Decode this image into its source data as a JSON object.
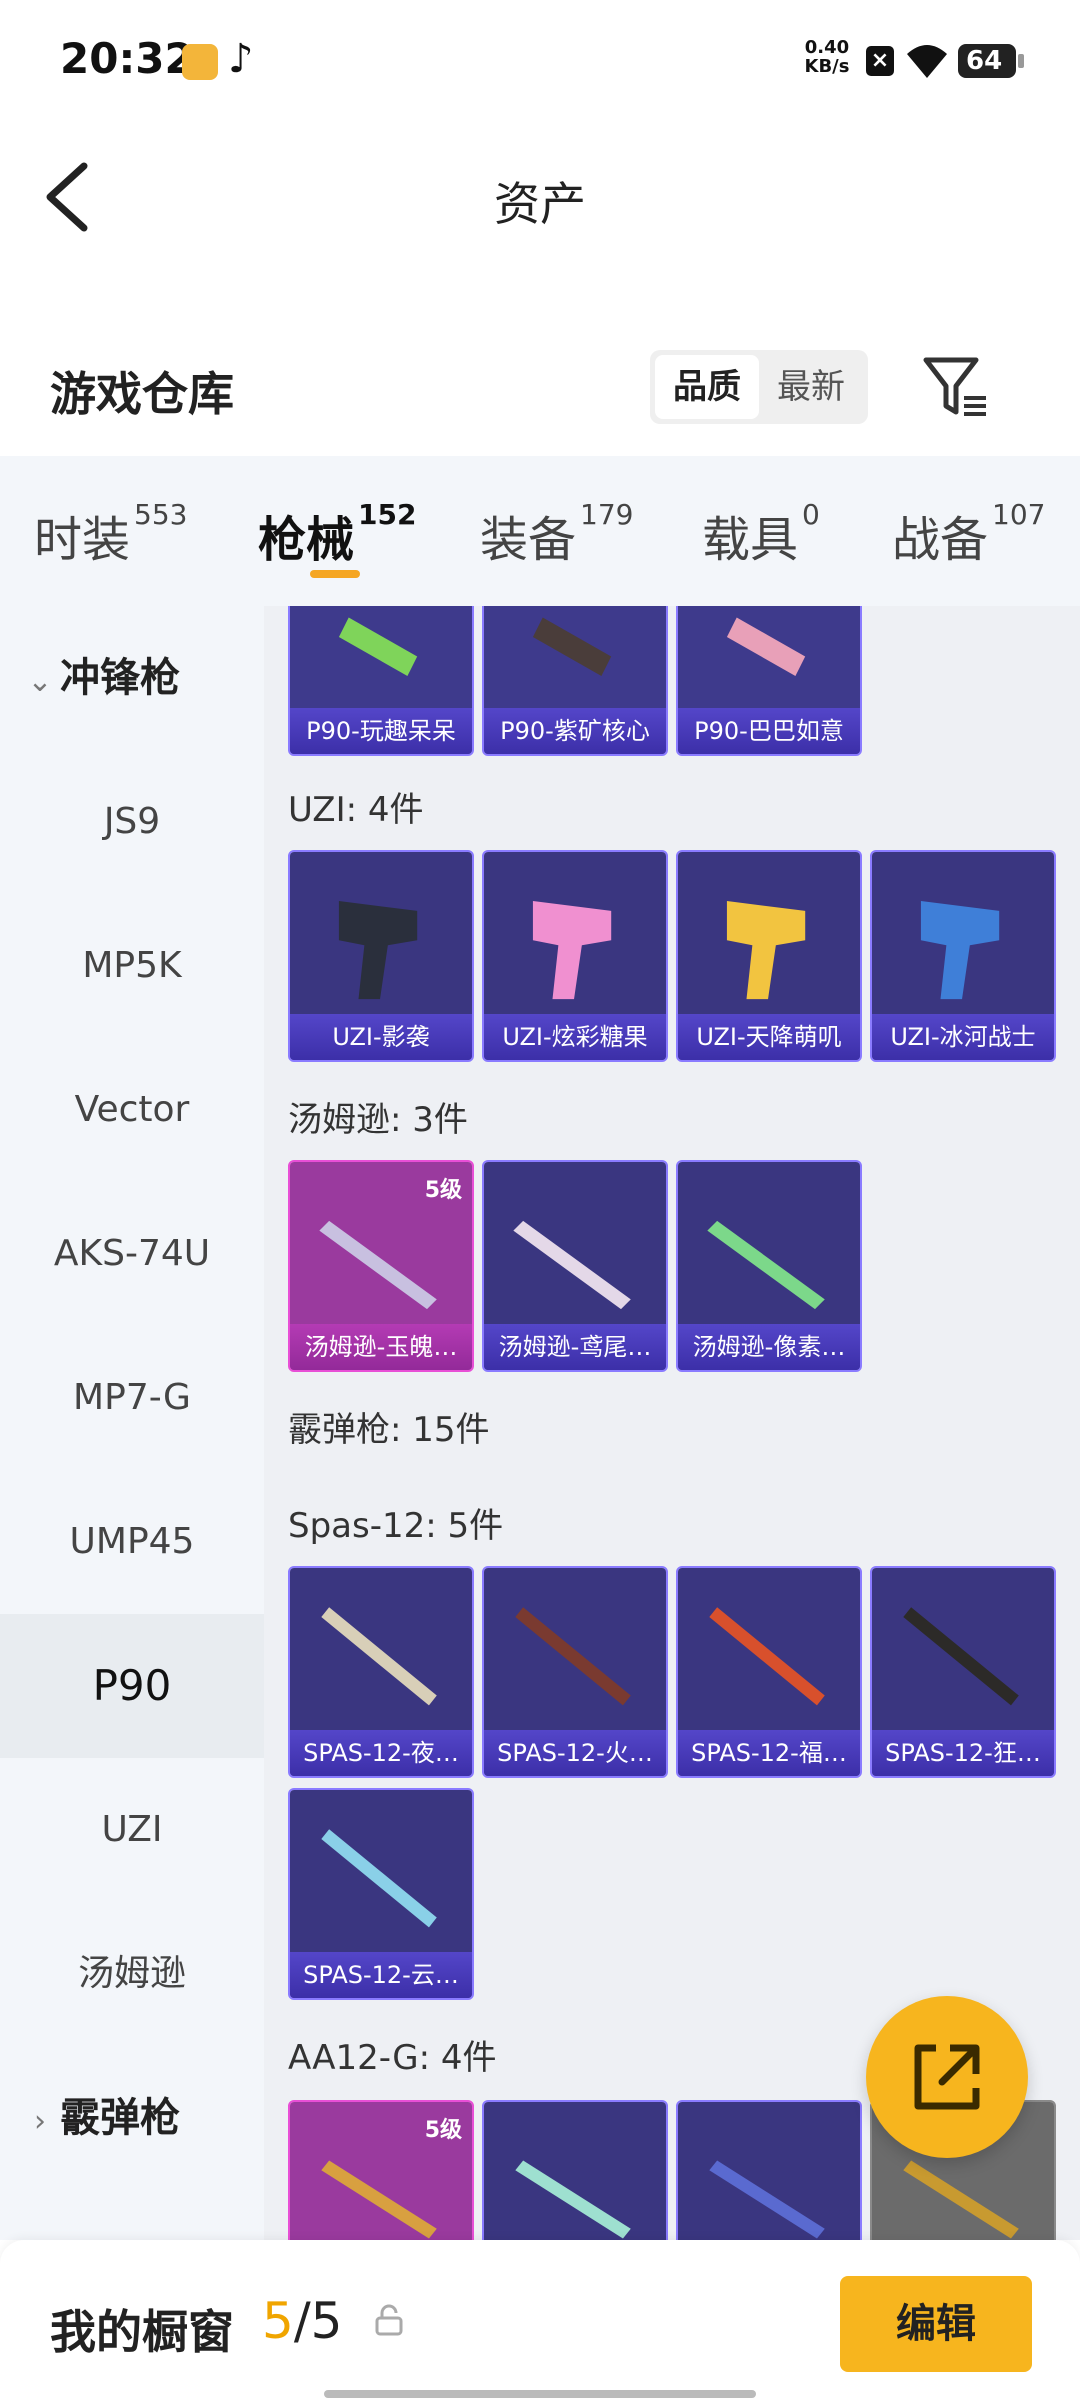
{
  "status": {
    "time": "20:32",
    "net_speed_value": "0.40",
    "net_speed_unit": "KB/s",
    "battery": "64"
  },
  "header": {
    "title": "资产"
  },
  "section": {
    "title": "游戏仓库",
    "sort_options": [
      "品质",
      "最新"
    ],
    "sort_active": "品质"
  },
  "tabs": [
    {
      "label": "时装",
      "count": "553"
    },
    {
      "label": "枪械",
      "count": "152"
    },
    {
      "label": "装备",
      "count": "179"
    },
    {
      "label": "载具",
      "count": "0"
    },
    {
      "label": "战备",
      "count": "107"
    }
  ],
  "sidebar": {
    "group_open": "冲锋枪",
    "items": [
      "JS9",
      "MP5K",
      "Vector",
      "AKS-74U",
      "MP7-G",
      "UMP45",
      "P90",
      "UZI",
      "汤姆逊"
    ],
    "active": "P90",
    "group_closed": "霰弹枪"
  },
  "content": {
    "p90_cards": [
      "P90-玩趣呆呆",
      "P90-紫矿核心",
      "P90-巴巴如意"
    ],
    "uzi": {
      "label": "UZI: 4件",
      "cards": [
        "UZI-影袭",
        "UZI-炫彩糖果",
        "UZI-天降萌叽",
        "UZI-冰河战士"
      ]
    },
    "thompson": {
      "label": "汤姆逊: 3件",
      "level": "5级",
      "cards": [
        "汤姆逊-玉魄…",
        "汤姆逊-鸢尾…",
        "汤姆逊-像素…"
      ]
    },
    "shotgun_label": "霰弹枪: 15件",
    "spas": {
      "label": "Spas-12: 5件",
      "cards": [
        "SPAS-12-夜…",
        "SPAS-12-火…",
        "SPAS-12-福…",
        "SPAS-12-狂…",
        "SPAS-12-云…"
      ]
    },
    "aa12": {
      "label": "AA12-G: 4件",
      "level": "5级"
    }
  },
  "bottom": {
    "label": "我的橱窗",
    "count_current": "5",
    "count_total": "/5",
    "edit": "编辑"
  }
}
